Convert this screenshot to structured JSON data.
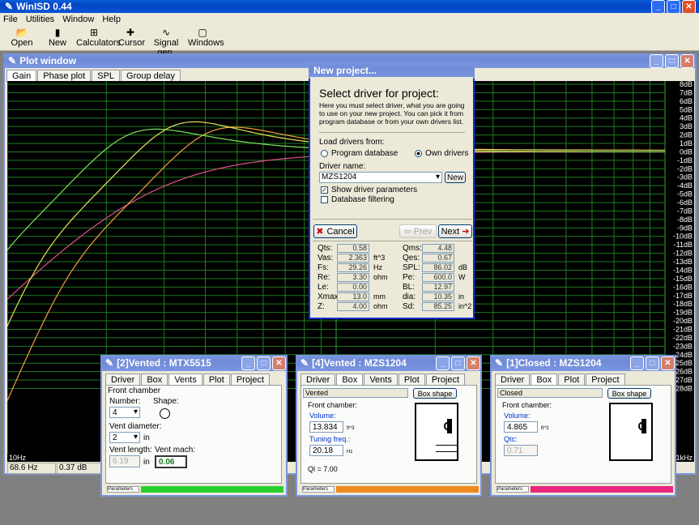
{
  "app": {
    "title": "WinISD 0.44"
  },
  "menu": [
    "File",
    "Utilities",
    "Window",
    "Help"
  ],
  "toolbar": [
    {
      "label": "Open",
      "icon": "folder-icon"
    },
    {
      "label": "New",
      "icon": "new-icon"
    },
    {
      "label": "Calculators",
      "icon": "calculator-icon"
    },
    {
      "label": "Cursor",
      "icon": "cursor-icon"
    },
    {
      "label": "Signal gen.",
      "icon": "signal-icon"
    },
    {
      "label": "Windows",
      "icon": "windows-icon"
    }
  ],
  "plot_window": {
    "title": "Plot window",
    "tabs": [
      "Gain",
      "Phase plot",
      "SPL",
      "Group delay"
    ],
    "y_ticks": [
      "8dB",
      "7dB",
      "6dB",
      "5dB",
      "4dB",
      "3dB",
      "2dB",
      "1dB",
      "0dB",
      "-1dB",
      "-2dB",
      "-3dB",
      "-4dB",
      "-5dB",
      "-6dB",
      "-7dB",
      "-8dB",
      "-9dB",
      "-10dB",
      "-11dB",
      "-12dB",
      "-13dB",
      "-14dB",
      "-15dB",
      "-16dB",
      "-17dB",
      "-18dB",
      "-19dB",
      "-20dB",
      "-21dB",
      "-22dB",
      "-23dB",
      "-24dB",
      "-25dB",
      "-26dB",
      "-27dB",
      "-28dB"
    ],
    "x_start": "10Hz",
    "x_end": "1kHz",
    "status": [
      "68.6 Hz",
      "0.37 dB"
    ],
    "line_colors": {
      "green": "#7de35a",
      "orange": "#f0a040",
      "pink": "#e05090",
      "yellow": "#e8e05a"
    }
  },
  "new_project": {
    "title": "New project...",
    "heading": "Select driver for project:",
    "description": "Here you must select driver, what you are going to use on your new project. You can pick it from program database or from your own drivers list.",
    "load_from": "Load drivers from:",
    "opt_program": "Program database",
    "opt_own": "Own drivers",
    "driver_name_label": "Driver name:",
    "driver_name": "MZS1204",
    "new_btn": "New",
    "show_params": "Show driver parameters",
    "db_filter": "Database filtering",
    "cancel": "Cancel",
    "prev": "Prev",
    "next": "Next",
    "params_left": [
      {
        "k": "Qts:",
        "v": "0.58",
        "u": ""
      },
      {
        "k": "Vas:",
        "v": "2.363",
        "u": "ft^3"
      },
      {
        "k": "Fs:",
        "v": "29.26",
        "u": "Hz"
      },
      {
        "k": "Re:",
        "v": "3.30",
        "u": "ohm"
      },
      {
        "k": "Le:",
        "v": "0.00",
        "u": ""
      },
      {
        "k": "Xmax:",
        "v": "13.0",
        "u": "mm"
      },
      {
        "k": "Z:",
        "v": "4.00",
        "u": "ohm"
      }
    ],
    "params_right": [
      {
        "k": "Qms:",
        "v": "4.48",
        "u": ""
      },
      {
        "k": "Qes:",
        "v": "0.67",
        "u": ""
      },
      {
        "k": "SPL:",
        "v": "86.02",
        "u": "dB"
      },
      {
        "k": "Pe:",
        "v": "600.0",
        "u": "W"
      },
      {
        "k": "BL:",
        "v": "12.97",
        "u": ""
      },
      {
        "k": "dia:",
        "v": "10.35",
        "u": "in"
      },
      {
        "k": "Sd:",
        "v": "85.25",
        "u": "in^2"
      }
    ]
  },
  "win2": {
    "title": "[2]Vented : MTX5515",
    "tabs": [
      "Driver",
      "Box",
      "Vents",
      "Plot",
      "Project"
    ],
    "front_chamber": "Front chamber",
    "number_label": "Number:",
    "number": "4",
    "shape_label": "Shape:",
    "vent_diam_label": "Vent diameter:",
    "vent_diam": "2",
    "vent_diam_unit": "in",
    "vent_len_label": "Vent length:",
    "vent_len": "6.19",
    "vent_len_unit": "in",
    "vent_mach_label": "Vent mach:",
    "vent_mach": "0.06",
    "params_tab": "Parameters",
    "bar_color": "#28d030"
  },
  "win4": {
    "title": "[4]Vented : MZS1204",
    "tabs": [
      "Driver",
      "Box",
      "Vents",
      "Plot",
      "Project"
    ],
    "type": "Vented",
    "box_shape": "Box shape",
    "front_chamber": "Front chamber:",
    "volume_label": "Volume:",
    "volume": "13.834",
    "volume_unit": "ft^3",
    "tuning_label": "Tuning freq.:",
    "tuning": "20.18",
    "tuning_unit": "Hz",
    "ql": "Ql = 7.00",
    "params_tab": "Parameters",
    "bar_color": "#f08a20"
  },
  "win1": {
    "title": "[1]Closed : MZS1204",
    "tabs": [
      "Driver",
      "Box",
      "Plot",
      "Project"
    ],
    "type": "Closed",
    "box_shape": "Box shape",
    "front_chamber": "Front chamber:",
    "volume_label": "Volume:",
    "volume": "4.865",
    "volume_unit": "ft^3",
    "qtc_label": "Qtc:",
    "qtc": "0.71",
    "params_tab": "Parameters",
    "bar_color": "#e8287c"
  }
}
